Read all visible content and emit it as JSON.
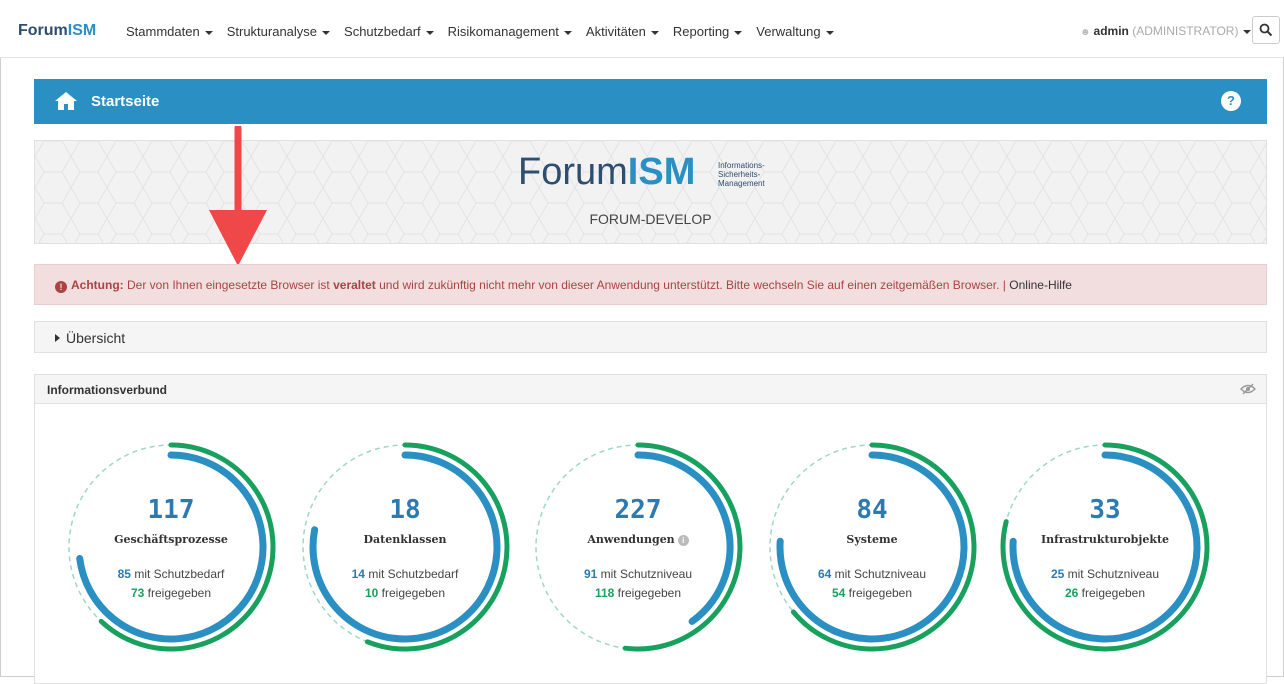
{
  "nav": {
    "brand_a": "Forum",
    "brand_b": "ISM",
    "menu": [
      "Stammdaten",
      "Strukturanalyse",
      "Schutzbedarf",
      "Risikomanagement",
      "Aktivitäten",
      "Reporting",
      "Verwaltung"
    ],
    "user_name": "admin",
    "user_role": "(ADMINISTRATOR)"
  },
  "header": {
    "title": "Startseite"
  },
  "banner": {
    "logo_a": "Forum",
    "logo_b": "ISM",
    "logo_sub": [
      "Informations-",
      "Sicherheits-",
      "Management"
    ],
    "instance": "FORUM-DEVELOP"
  },
  "alert": {
    "prefix": "Achtung:",
    "text1": " Der von Ihnen eingesetzte Browser ist ",
    "strong": "veraltet",
    "text2": " und wird zukünftig nicht mehr von dieser Anwendung unterstützt. Bitte wechseln Sie auf einen zeitgemäßen Browser. | ",
    "link": "Online-Hilfe"
  },
  "overview": {
    "label": "Übersicht"
  },
  "panel": {
    "title": "Informationsverbund"
  },
  "gauges": [
    {
      "count": "117",
      "label": "Geschäftsprozesse",
      "n1": "85",
      "t1": " mit Schutzbedarf",
      "n2": "73",
      "t2": " freigegeben",
      "info": false,
      "blue_frac": 0.73,
      "green_frac": 0.62
    },
    {
      "count": "18",
      "label": "Datenklassen",
      "n1": "14",
      "t1": " mit Schutzbedarf",
      "n2": "10",
      "t2": " freigegeben",
      "info": false,
      "blue_frac": 0.78,
      "green_frac": 0.56
    },
    {
      "count": "227",
      "label": "Anwendungen",
      "n1": "91",
      "t1": " mit Schutzniveau",
      "n2": "118",
      "t2": " freigegeben",
      "info": true,
      "blue_frac": 0.4,
      "green_frac": 0.52
    },
    {
      "count": "84",
      "label": "Systeme",
      "n1": "64",
      "t1": " mit Schutzniveau",
      "n2": "54",
      "t2": " freigegeben",
      "info": false,
      "blue_frac": 0.76,
      "green_frac": 0.64
    },
    {
      "count": "33",
      "label": "Infrastrukturobjekte",
      "n1": "25",
      "t1": " mit Schutzniveau",
      "n2": "26",
      "t2": " freigegeben",
      "info": false,
      "blue_frac": 0.76,
      "green_frac": 0.79
    }
  ],
  "colors": {
    "primary": "#2a8fc3",
    "green": "#18a05e",
    "alert_bg": "#f2dede",
    "arrow": "#f04848"
  }
}
